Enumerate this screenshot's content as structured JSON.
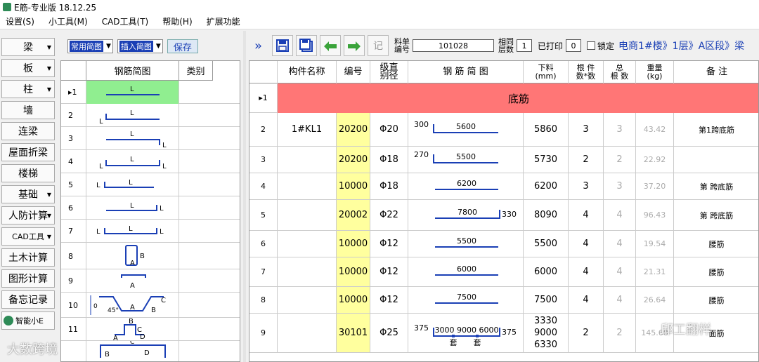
{
  "window": {
    "title": "E筋-专业版 18.12.25"
  },
  "menu": [
    "设置(S)",
    "小工具(M)",
    "CAD工具(T)",
    "帮助(H)",
    "扩展功能"
  ],
  "nav": [
    {
      "label": "梁",
      "dd": true
    },
    {
      "label": "板",
      "dd": true
    },
    {
      "label": "柱",
      "dd": true
    },
    {
      "label": "墙",
      "dd": false
    },
    {
      "label": "连梁",
      "dd": false
    },
    {
      "label": "屋面折梁",
      "dd": false
    },
    {
      "label": "楼梯",
      "dd": false
    },
    {
      "label": "基础",
      "dd": true
    },
    {
      "label": "人防计算",
      "dd": true
    },
    {
      "label": "CAD工具",
      "dd": true
    },
    {
      "label": "土木计算",
      "dd": false
    },
    {
      "label": "图形计算",
      "dd": false
    },
    {
      "label": "备忘记录",
      "dd": false
    },
    {
      "label": "智能小E",
      "dd": false
    }
  ],
  "controls": {
    "shape_select": "常用简图",
    "insert_select": "插入简图",
    "save": "保存"
  },
  "shape_panel": {
    "headers": [
      "钢筋简图",
      "类别"
    ],
    "rows": [
      "1",
      "2",
      "3",
      "4",
      "5",
      "6",
      "7",
      "8",
      "9",
      "10",
      "11"
    ],
    "labels": {
      "L": "L",
      "A": "A",
      "B": "B",
      "C": "C",
      "D": "D",
      "deg": "45°",
      "zero": "0"
    }
  },
  "toolbar": {
    "expand": "»",
    "ji": "记",
    "liaodan_label": [
      "料单",
      "编号"
    ],
    "liaodan_value": "101028",
    "xiangtong_label": [
      "相同",
      "层数"
    ],
    "xiangtong_value": "1",
    "printed_label": "已打印",
    "printed_value": "0",
    "lock_label": "锁定",
    "breadcrumb": "电商1#楼》1层》A区段》梁"
  },
  "grid": {
    "headers": [
      "构件名称",
      "编号",
      "级直\n别径",
      "钢 筋 简 图",
      "下料\n(mm)",
      "根 件\n数*数",
      "总\n根 数",
      "重量\n(kg)",
      "备    注"
    ],
    "group": {
      "num": "1",
      "label": "底筋"
    },
    "rows": [
      {
        "num": "2",
        "name": "1#KL1",
        "code": "20200",
        "grade": "Φ20",
        "left": "300",
        "mid": "5600",
        "right": "",
        "cut": "5860",
        "n": "3",
        "total": "3",
        "weight": "43.42",
        "note": "第1跨底筋"
      },
      {
        "num": "3",
        "name": "",
        "code": "20200",
        "grade": "Φ18",
        "left": "270",
        "mid": "5500",
        "right": "",
        "cut": "5730",
        "n": "2",
        "total": "2",
        "weight": "22.92",
        "note": ""
      },
      {
        "num": "4",
        "name": "",
        "code": "10000",
        "grade": "Φ18",
        "left": "",
        "mid": "6200",
        "right": "",
        "cut": "6200",
        "n": "3",
        "total": "3",
        "weight": "37.20",
        "note": "第 跨底筋"
      },
      {
        "num": "5",
        "name": "",
        "code": "20002",
        "grade": "Φ22",
        "left": "",
        "mid": "7800",
        "right": "330",
        "cut": "8090",
        "n": "4",
        "total": "4",
        "weight": "96.43",
        "note": "第 跨底筋"
      },
      {
        "num": "6",
        "name": "",
        "code": "10000",
        "grade": "Φ12",
        "left": "",
        "mid": "5500",
        "right": "",
        "cut": "5500",
        "n": "4",
        "total": "4",
        "weight": "19.54",
        "note": "腰筋"
      },
      {
        "num": "7",
        "name": "",
        "code": "10000",
        "grade": "Φ12",
        "left": "",
        "mid": "6000",
        "right": "",
        "cut": "6000",
        "n": "4",
        "total": "4",
        "weight": "21.31",
        "note": "腰筋"
      },
      {
        "num": "8",
        "name": "",
        "code": "10000",
        "grade": "Φ12",
        "left": "",
        "mid": "7500",
        "right": "",
        "cut": "7500",
        "n": "4",
        "total": "4",
        "weight": "26.64",
        "note": "腰筋"
      },
      {
        "num": "9",
        "name": "",
        "code": "30101",
        "grade": "Φ25",
        "left": "375",
        "mid": "3000 9000 6000",
        "right": "375",
        "cut": "3330\n9000\n6330",
        "n": "2",
        "total": "2",
        "weight": "145.68",
        "note": "面筋",
        "tao": "套"
      }
    ]
  },
  "watermarks": {
    "left": "大数跨境",
    "right": "邱工翻样"
  },
  "colors": {
    "accent": "#1a3fb5",
    "group_bg": "#ff7676",
    "code_bg": "#ffff9e",
    "selected_shape": "#90ee90"
  }
}
